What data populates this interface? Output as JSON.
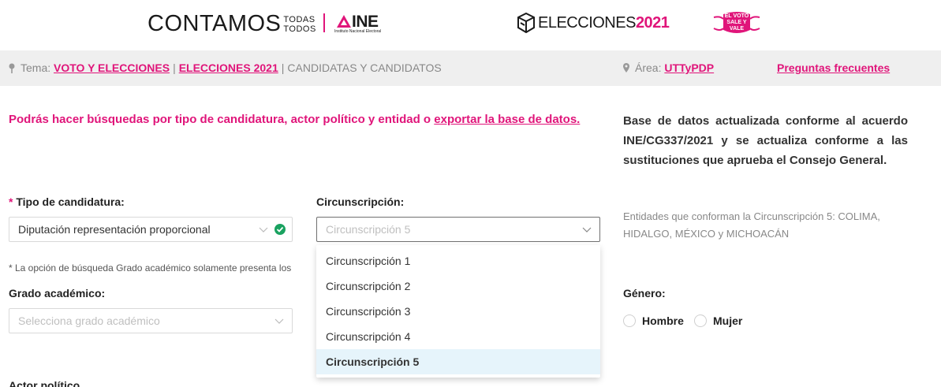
{
  "header": {
    "contamos_big": "CONTAMOS",
    "contamos_small_1": "TODAS",
    "contamos_small_2": "TODOS",
    "ine_text": "INE",
    "ine_sub": "Instituto Nacional Electoral",
    "elecciones_text": "ELECCIONES",
    "elecciones_year": "2021",
    "mask_text": "EL VOTO SALE Y VALE"
  },
  "breadcrumb": {
    "tema_label": "Tema:",
    "link_1": "VOTO Y ELECCIONES",
    "sep_1": "|",
    "link_2": "ELECCIONES 2021",
    "sep_2": "|",
    "current": "CANDIDATAS Y CANDIDATOS",
    "area_label": "Área:",
    "area_link": "UTTyPDP",
    "faq_link": "Preguntas frecuentes"
  },
  "intro": {
    "text": "Podrás hacer búsquedas por tipo de candidatura, actor político y entidad o ",
    "link": "exportar la base de datos."
  },
  "note_right": "Base de datos actualizada conforme al acuerdo INE/CG337/2021 y se actualiza conforme a las sustituciones que aprueba el Consejo General.",
  "form": {
    "tipo_required": "*",
    "tipo_label": "Tipo de candidatura:",
    "tipo_value": "Diputación representación proporcional",
    "circ_label": "Circunscripción:",
    "circ_placeholder": "Circunscripción 5",
    "entities_text": "Entidades que conforman la Circunscripción 5: COLIMA, HIDALGO, MÉXICO y MICHOACÁN",
    "grado_note": "* La opción de búsqueda Grado académico solamente presenta los",
    "grado_label": "Grado académico:",
    "grado_placeholder": "Selecciona grado académico",
    "genero_label": "Género:",
    "genero_options": [
      "Hombre",
      "Mujer"
    ],
    "actor_label": "Actor político"
  },
  "dropdown": {
    "options": [
      "Circunscripción 1",
      "Circunscripción 2",
      "Circunscripción 3",
      "Circunscripción 4",
      "Circunscripción 5"
    ],
    "selected": "Circunscripción 5"
  },
  "colors": {
    "brand_pink": "#e0157a",
    "success_green": "#1aa260",
    "selected_bg": "#e6f4fb"
  }
}
